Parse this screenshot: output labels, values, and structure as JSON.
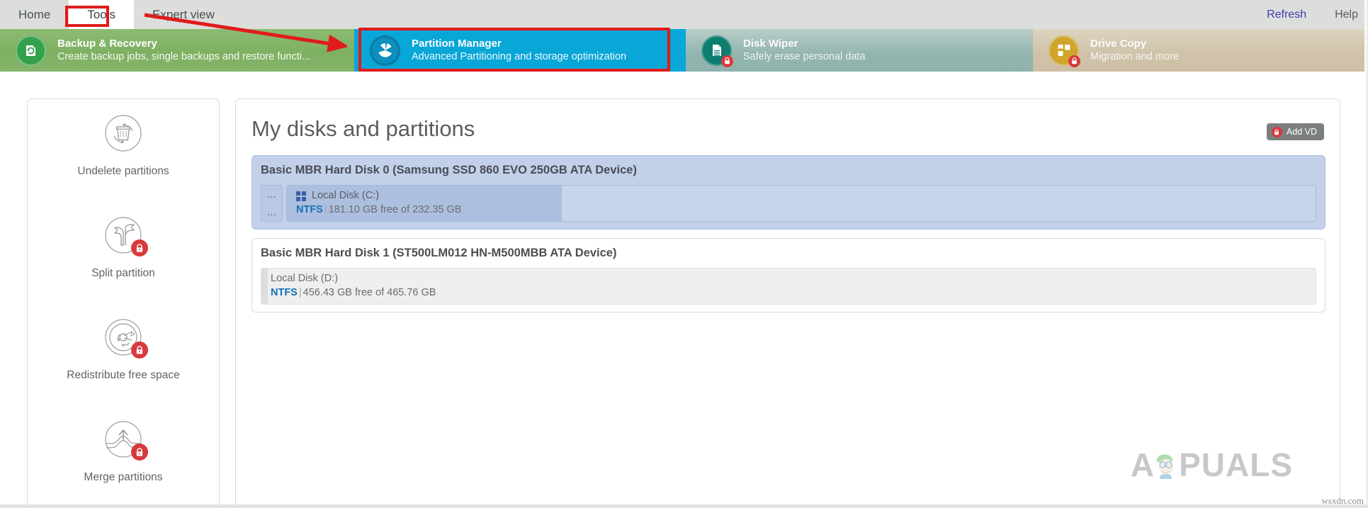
{
  "menubar": {
    "tabs": [
      {
        "label": "Home",
        "active": false
      },
      {
        "label": "Tools",
        "active": true
      },
      {
        "label": "Expert view",
        "active": false
      }
    ],
    "refresh_label": "Refresh",
    "help_label": "Help"
  },
  "tiles": [
    {
      "title": "Backup & Recovery",
      "subtitle": "Create backup jobs, single backups and restore functi...",
      "icon": "backup-recovery-icon",
      "locked": false
    },
    {
      "title": "Partition Manager",
      "subtitle": "Advanced Partitioning and storage optimization",
      "icon": "pie-chart-icon",
      "locked": false
    },
    {
      "title": "Disk Wiper",
      "subtitle": "Safely erase personal data",
      "icon": "document-shred-icon",
      "locked": true
    },
    {
      "title": "Drive Copy",
      "subtitle": "Migration and more",
      "icon": "drive-copy-icon",
      "locked": true
    }
  ],
  "sidebar": {
    "items": [
      {
        "label": "Undelete partitions",
        "icon": "undelete-partitions-icon",
        "locked": false
      },
      {
        "label": "Split partition",
        "icon": "split-partition-icon",
        "locked": true
      },
      {
        "label": "Redistribute free space",
        "icon": "redistribute-free-space-icon",
        "locked": true
      },
      {
        "label": "Merge partitions",
        "icon": "merge-partitions-icon",
        "locked": true
      }
    ]
  },
  "main": {
    "title": "My disks and partitions",
    "add_vd": {
      "label": "Add VD",
      "icon": "lock-icon"
    },
    "disks": [
      {
        "title": "Basic MBR Hard Disk 0 (Samsung SSD 860 EVO 250GB ATA Device)",
        "selected": true,
        "ellipsis_top": "...",
        "ellipsis_bottom": "...",
        "partition": {
          "name": "Local Disk (C:)",
          "filesystem": "NTFS",
          "separator": "|",
          "capacity_text": "181.10 GB free of 232.35 GB",
          "free_gb": 181.1,
          "total_gb": 232.35,
          "icon": "windows-logo-icon"
        }
      },
      {
        "title": "Basic MBR Hard Disk 1 (ST500LM012 HN-M500MBB ATA Device)",
        "selected": false,
        "partition": {
          "name": "Local Disk (D:)",
          "filesystem": "NTFS",
          "separator": "|",
          "capacity_text": "456.43 GB free of 465.76 GB",
          "free_gb": 456.43,
          "total_gb": 465.76
        }
      }
    ]
  },
  "watermarks": {
    "brand": "APPUALS",
    "site": "wsxdn.com"
  },
  "colors": {
    "accent_blue": "#09a6d8",
    "backup_green": "#7eb062",
    "wiper_teal": "#92b5b0",
    "drive_gold": "#cfc2a9",
    "annotation_red": "#e01b1b",
    "selected_disk": "#c2d0ea",
    "fs_label": "#1272b5",
    "lock_red": "#d8393d"
  }
}
